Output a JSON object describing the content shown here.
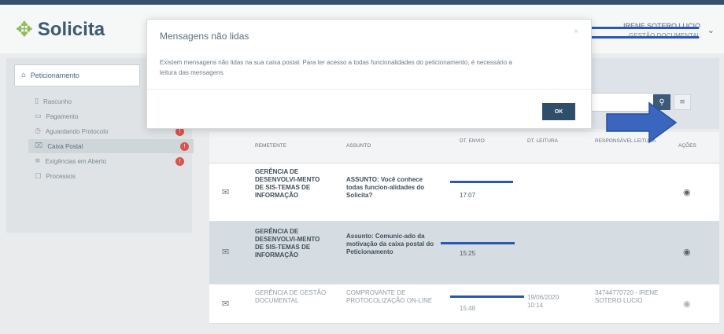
{
  "app": {
    "name": "Solicita",
    "logo_icon": "puzzle-icon"
  },
  "user": {
    "name": "IRENE SOTERO LUCIO",
    "subtitle": "GESTÃO DOCUMENTAL"
  },
  "sidebar": {
    "header": "Peticionamento",
    "items": [
      {
        "label": "Rascunho",
        "icon": "file-icon",
        "badge": ""
      },
      {
        "label": "Pagamento",
        "icon": "card-icon",
        "badge": ""
      },
      {
        "label": "Aguardando Protocolo",
        "icon": "clock-icon",
        "badge": "!"
      },
      {
        "label": "Caixa Postal",
        "icon": "lock-icon",
        "badge": "!",
        "active": true
      },
      {
        "label": "Exigências em Aberto",
        "icon": "list-icon",
        "badge": "!"
      },
      {
        "label": "Processos",
        "icon": "folder-icon",
        "badge": ""
      }
    ]
  },
  "table": {
    "headers": [
      "REMETENTE",
      "ASSUNTO",
      "DT. ENVIO",
      "DT. LEITURA",
      "RESPONSÁVEL LEITURA",
      "AÇÕES"
    ],
    "rows": [
      {
        "remetente": "GERÊNCIA DE DESENVOLVI-MENTO DE SIS-TEMAS DE INFORMAÇÃO",
        "assunto": "ASSUNTO: Você conhece todas funcion-alidades do Solicita?",
        "envio": "17:07",
        "leitura": "",
        "responsavel": "",
        "read": false
      },
      {
        "remetente": "GERÊNCIA DE DESENVOLVI-MENTO DE SIS-TEMAS DE INFORMAÇÃO",
        "assunto": "Assunto: Comunic-ado da motivação da caixa postal do Peticionamento",
        "envio": "15:25",
        "leitura": "",
        "responsavel": "",
        "read": false
      },
      {
        "remetente": "GERÊNCIA DE GESTÃO DOCUMENTAL",
        "assunto": "COMPROVANTE DE PROTOCOLIZAÇÃO ON-LINE",
        "envio": "15:48",
        "leitura": "19/06/2020 10:14",
        "responsavel": "34744770720 - IRENE SOTERO LUCIO",
        "read": true
      }
    ]
  },
  "modal": {
    "title": "Mensagens não lidas",
    "body": "Existem mensagens não lidas na sua caixa postal. Para ter acesso a todas funcionalidades do peticionamento, é necessário a leitura das mensagens.",
    "close": "×",
    "ok_label": "OK"
  },
  "colors": {
    "accent": "#2f4e6a",
    "badge": "#d9534f",
    "arrow": "#3a66c0",
    "redact": "#2a56b8"
  }
}
